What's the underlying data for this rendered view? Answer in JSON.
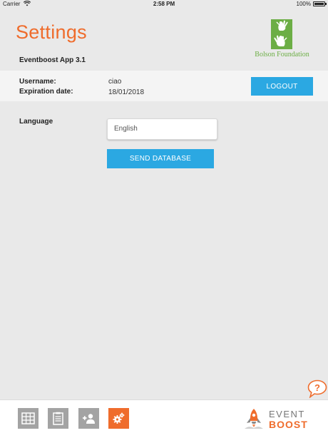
{
  "status_bar": {
    "carrier": "Carrier",
    "time": "2:58 PM",
    "battery": "100%"
  },
  "header": {
    "title": "Settings",
    "logo_text": "Bolson Foundation",
    "app_version": "Eventboost App 3.1"
  },
  "user": {
    "username_label": "Username:",
    "username_value": "ciao",
    "expiration_label": "Expiration date:",
    "expiration_value": "18/01/2018",
    "logout_label": "LOGOUT"
  },
  "language": {
    "label": "Language",
    "value": "English"
  },
  "send_database_label": "SEND DATABASE",
  "help_icon": "question-bubble-icon",
  "bottom_nav": {
    "items": [
      {
        "icon": "grid-icon",
        "active": false
      },
      {
        "icon": "clipboard-icon",
        "active": false
      },
      {
        "icon": "add-user-icon",
        "active": false
      },
      {
        "icon": "gears-icon",
        "active": true
      }
    ]
  },
  "brand": {
    "top": "EVENT",
    "bottom": "BOOST"
  },
  "colors": {
    "accent": "#ef6c2c",
    "button": "#2ba8e2",
    "logo_green": "#6cae45",
    "nav_inactive": "#a3a3a3"
  }
}
